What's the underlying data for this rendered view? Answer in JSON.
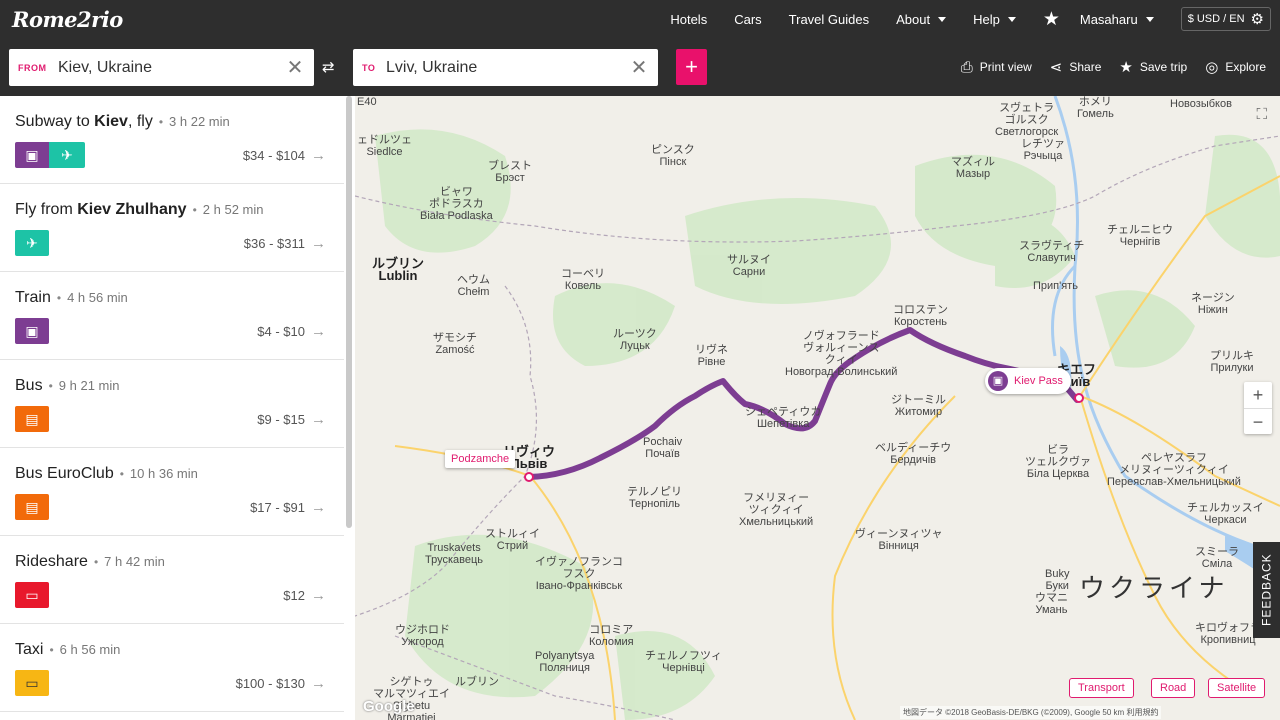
{
  "app": {
    "logo": "Rome2rio"
  },
  "nav": {
    "hotels": "Hotels",
    "cars": "Cars",
    "travel_guides": "Travel Guides",
    "about": "About",
    "help": "Help",
    "user": "Masaharu",
    "currency": "$ USD / EN"
  },
  "search": {
    "from_tag": "FROM",
    "from_value": "Kiev, Ukraine",
    "to_tag": "TO",
    "to_value": "Lviv, Ukraine"
  },
  "actions": {
    "print": "Print view",
    "share": "Share",
    "save": "Save trip",
    "explore": "Explore"
  },
  "routes": [
    {
      "title_pre": "Subway to ",
      "title_bold": "Kiev",
      "title_post": ", fly",
      "duration": "3 h 22 min",
      "price": "$34 - $104",
      "modes": [
        "train",
        "fly"
      ]
    },
    {
      "title_pre": "Fly from ",
      "title_bold": "Kiev Zhulhany",
      "title_post": "",
      "duration": "2 h 52 min",
      "price": "$36 - $311",
      "modes": [
        "fly"
      ]
    },
    {
      "title_pre": "Train",
      "title_bold": "",
      "title_post": "",
      "duration": "4 h 56 min",
      "price": "$4 - $10",
      "modes": [
        "train"
      ]
    },
    {
      "title_pre": "Bus",
      "title_bold": "",
      "title_post": "",
      "duration": "9 h 21 min",
      "price": "$9 - $15",
      "modes": [
        "bus"
      ]
    },
    {
      "title_pre": "Bus EuroClub",
      "title_bold": "",
      "title_post": "",
      "duration": "10 h 36 min",
      "price": "$17 - $91",
      "modes": [
        "bus"
      ]
    },
    {
      "title_pre": "Rideshare",
      "title_bold": "",
      "title_post": "",
      "duration": "7 h 42 min",
      "price": "$12",
      "modes": [
        "ride"
      ]
    },
    {
      "title_pre": "Taxi",
      "title_bold": "",
      "title_post": "",
      "duration": "6 h 56 min",
      "price": "$100 - $130",
      "modes": [
        "taxi"
      ]
    }
  ],
  "map": {
    "pins": {
      "start": "Podzamche",
      "end": "Kiev Pass"
    },
    "country": "ウクライナ",
    "labels": [
      {
        "text": "スヴェトラ\nゴルスク\nСветлогорск",
        "big": false
      },
      {
        "text": "ホメリ\nГомель",
        "big": false
      },
      {
        "text": "Новозыбков",
        "big": false
      },
      {
        "text": "ェドルツェ\nSiedlce",
        "big": false
      },
      {
        "text": "ピンスク\nПінск",
        "big": false
      },
      {
        "text": "マズィル\nМазыр",
        "big": false
      },
      {
        "text": "レチツァ\nРэчыца",
        "big": false
      },
      {
        "text": "ブレスト\nБрэст",
        "big": false
      },
      {
        "text": "ビャワ\nポドラスカ\nBiała Podlaska",
        "big": false
      },
      {
        "text": "チェルニヒウ\nЧернігів",
        "big": false
      },
      {
        "text": "スラヴティチ\nСлавутич",
        "big": false
      },
      {
        "text": "ルブリン\nLublin",
        "big": true
      },
      {
        "text": "コーベリ\nКовель",
        "big": false
      },
      {
        "text": "サルヌイ\nСарни",
        "big": false
      },
      {
        "text": "Прип'ять",
        "big": false
      },
      {
        "text": "ヘウム\nChełm",
        "big": false
      },
      {
        "text": "ネージン\nНіжин",
        "big": false
      },
      {
        "text": "コロステン\nКоростень",
        "big": false
      },
      {
        "text": "ザモシチ\nZamość",
        "big": false
      },
      {
        "text": "ルーツク\nЛуцьк",
        "big": false
      },
      {
        "text": "リヴネ\nРівне",
        "big": false
      },
      {
        "text": "ノヴォフラード\nヴォルィーンス\nクィイ\nНовоград-Волинський",
        "big": false
      },
      {
        "text": "キエフ\nКиїв",
        "big": true
      },
      {
        "text": "プリルキ\nПрилуки",
        "big": false
      },
      {
        "text": "ジトーミル\nЖитомир",
        "big": false
      },
      {
        "text": "シェペティウカ\nШепетівка",
        "big": false
      },
      {
        "text": "ベルディーチウ\nБердичів",
        "big": false
      },
      {
        "text": "ビラ\nツェルクヴァ\nБіла Церква",
        "big": false
      },
      {
        "text": "ペレヤスラフ\nメリヌィーツィクィイ\nПереяслав-Хмельницький",
        "big": false
      },
      {
        "text": "リヴィウ\nЛьвів",
        "big": true
      },
      {
        "text": "Pochaiv\nПочаїв",
        "big": false
      },
      {
        "text": "テルノピリ\nТернопіль",
        "big": false
      },
      {
        "text": "フメリヌィー\nツィクィイ\nХмельницький",
        "big": false
      },
      {
        "text": "チェルカッスイ\nЧеркаси",
        "big": false
      },
      {
        "text": "ストルィイ\nСтрий",
        "big": false
      },
      {
        "text": "Truskavets\nТрускавець",
        "big": false
      },
      {
        "text": "ヴィーンヌィツャ\nВінниця",
        "big": false
      },
      {
        "text": "スミーラ\nСміла",
        "big": false
      },
      {
        "text": "イヴァノフランコ\nフスク\nІвано-Франківськ",
        "big": false
      },
      {
        "text": "Buky\nБуки",
        "big": false
      },
      {
        "text": "ウマニ\nУмань",
        "big": false
      },
      {
        "text": "ウジホロド\nУжгород",
        "big": false
      },
      {
        "text": "コロミア\nКоломия",
        "big": false
      },
      {
        "text": "Polyanytsya\nПоляниця",
        "big": false
      },
      {
        "text": "チェルノフツィ\nЧернівці",
        "big": false
      },
      {
        "text": "キロヴォフラ\nКропивниц",
        "big": false
      },
      {
        "text": "シゲトゥ\nマルマツィエイ\nSighetu\nMarmatiei",
        "big": false
      },
      {
        "text": "ルブリン",
        "big": false
      },
      {
        "text": "E40",
        "big": false
      }
    ],
    "map_types": [
      "Transport",
      "Road",
      "Satellite"
    ],
    "feedback": "FEEDBACK",
    "google": "Google",
    "attribution": "地図データ ©2018 GeoBasis-DE/BKG (©2009), Google   50 km",
    "terms": "利用規約"
  },
  "colors": {
    "brand": "#e9116b",
    "route": "#7d3d92",
    "nav_bg": "#2e2e2e"
  }
}
